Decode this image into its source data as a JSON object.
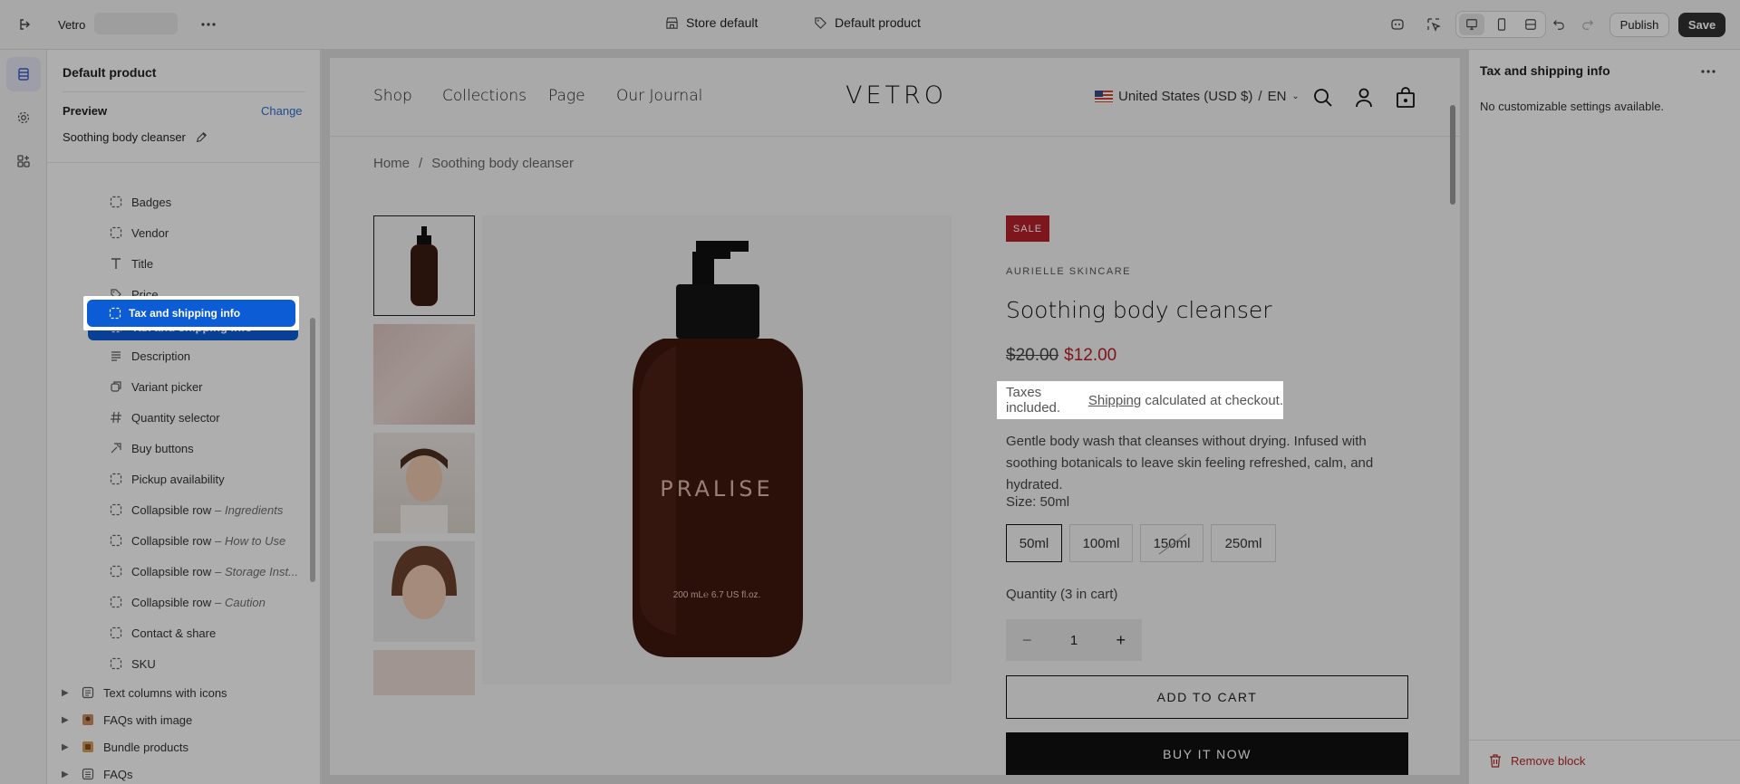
{
  "topbar": {
    "store_name": "Vetro",
    "store_template": "Store default",
    "product_template": "Default product",
    "publish_label": "Publish",
    "save_label": "Save"
  },
  "sidebar": {
    "title": "Default product",
    "preview_label": "Preview",
    "change_label": "Change",
    "preview_product": "Soothing body cleanser",
    "blocks": [
      {
        "label": "Badges",
        "icon": "block-icon"
      },
      {
        "label": "Vendor",
        "icon": "block-icon"
      },
      {
        "label": "Title",
        "icon": "title-icon"
      },
      {
        "label": "Price",
        "icon": "price-tag-icon"
      },
      {
        "label": "Tax and shipping info",
        "icon": "block-icon",
        "selected": true
      },
      {
        "label": "Description",
        "icon": "text-lines-icon"
      },
      {
        "label": "Variant picker",
        "icon": "variant-icon"
      },
      {
        "label": "Quantity selector",
        "icon": "hash-icon"
      },
      {
        "label": "Buy buttons",
        "icon": "buy-icon"
      },
      {
        "label": "Pickup availability",
        "icon": "block-icon"
      },
      {
        "label": "Collapsible row",
        "sub": "– Ingredients",
        "icon": "block-icon"
      },
      {
        "label": "Collapsible row",
        "sub": "– How to Use",
        "icon": "block-icon"
      },
      {
        "label": "Collapsible row",
        "sub": "– Storage Inst...",
        "icon": "block-icon"
      },
      {
        "label": "Collapsible row",
        "sub": "– Caution",
        "icon": "block-icon"
      },
      {
        "label": "Contact & share",
        "icon": "block-icon"
      },
      {
        "label": "SKU",
        "icon": "block-icon"
      }
    ],
    "sections": [
      {
        "label": "Text columns with icons"
      },
      {
        "label": "FAQs with image"
      },
      {
        "label": "Bundle products"
      },
      {
        "label": "FAQs"
      }
    ]
  },
  "store": {
    "nav": [
      "Shop",
      "Collections",
      "Page",
      "Our Journal"
    ],
    "logo": "VETRO",
    "locale": "United States (USD $)",
    "language": "EN",
    "breadcrumb_home": "Home",
    "breadcrumb_sep": "/",
    "breadcrumb_current": "Soothing body cleanser",
    "sale_badge": "SALE",
    "vendor": "AURIELLE SKINCARE",
    "product_title": "Soothing body cleanser",
    "compare_price": "$20.00",
    "price": "$12.00",
    "tax_text_before": "Taxes included.",
    "tax_link": "Shipping",
    "tax_text_after": " calculated at checkout.",
    "description": "Gentle body wash that cleanses without drying. Infused with soothing botanicals to leave skin feeling refreshed, calm, and hydrated.",
    "size_label": "Size: 50ml",
    "sizes": [
      "50ml",
      "100ml",
      "150ml",
      "250ml"
    ],
    "quantity_label": "Quantity (3 in cart)",
    "quantity_value": "1",
    "add_to_cart": "ADD TO CART",
    "buy_now": "BUY IT NOW",
    "bottle_brand": "PRALISE",
    "bottle_volume": "200 mL℮ 6.7 US fl.oz."
  },
  "right_panel": {
    "title": "Tax and shipping info",
    "message": "No customizable settings available.",
    "remove_label": "Remove block"
  },
  "colors": {
    "selected_blue": "#0b5cd5",
    "sale_red": "#b3202a",
    "save_button": "#303030",
    "remove_red": "#b0272a"
  }
}
